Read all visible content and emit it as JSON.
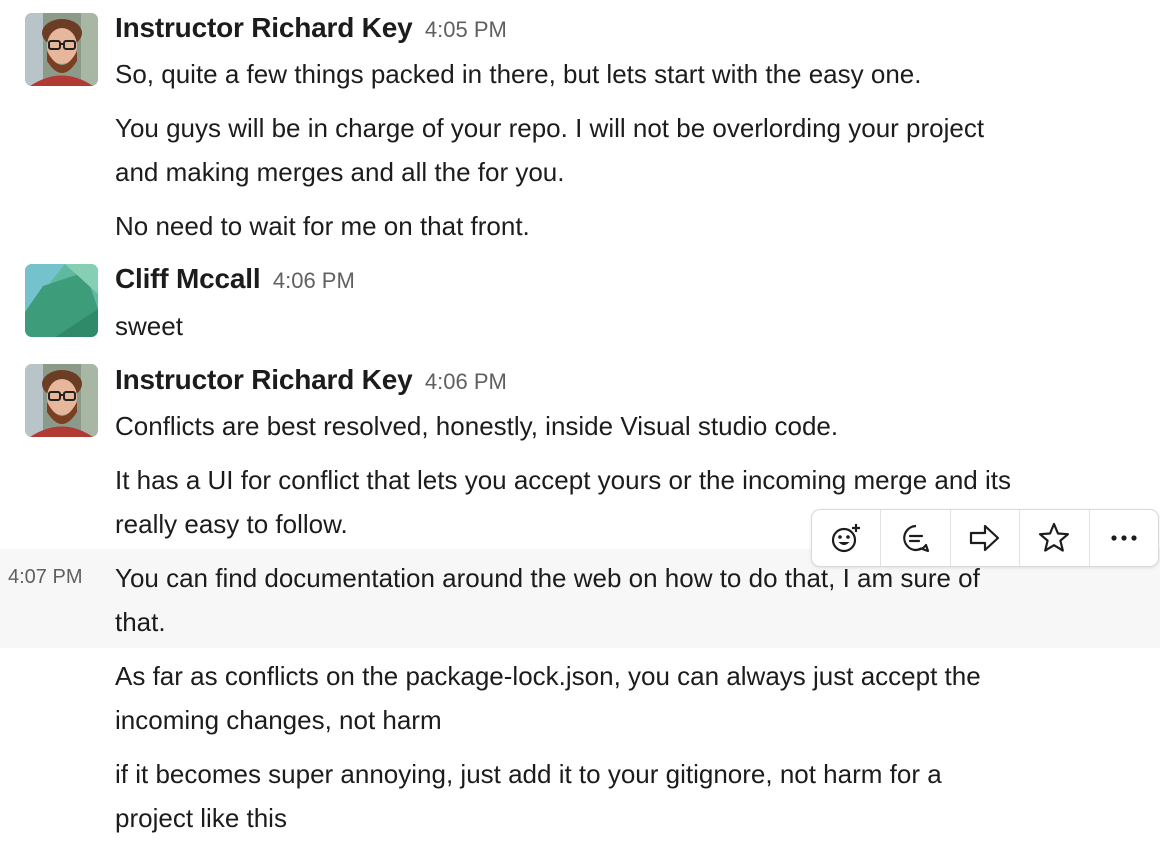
{
  "messages": [
    {
      "author": "Instructor Richard Key",
      "time": "4:05 PM",
      "lines": [
        "So, quite a few things packed in there, but lets start with the easy one.",
        "You guys will be in charge of your repo. I will not be overlording your project",
        "and making merges and all the for you.",
        "No need to wait for me on that front."
      ]
    },
    {
      "author": "Cliff Mccall",
      "time": "4:06 PM",
      "lines": [
        "sweet"
      ]
    },
    {
      "author": "Instructor Richard Key",
      "time": "4:06 PM",
      "lines": [
        "Conflicts are best resolved, honestly, inside Visual studio code.",
        "It has a UI for conflict that lets you accept yours or the incoming merge and its",
        "really easy to follow."
      ]
    }
  ],
  "continuation": {
    "time": "4:07 PM",
    "lines": [
      "You can find documentation around the web on how to do that, I am sure of",
      "that.",
      "As far as conflicts on the package-lock.json, you can always just accept the",
      "incoming changes, not harm",
      "if it becomes super annoying, just add it to your gitignore, not harm for a",
      "project like this"
    ]
  },
  "actions": {
    "icons": [
      "add-reaction-icon",
      "reply-thread-icon",
      "share-message-icon",
      "star-icon",
      "more-actions-icon"
    ]
  },
  "colors": {
    "text": "#1d1c1d",
    "timestamp": "#616061",
    "hover_background": "#f7f7f7",
    "avatar_green": "#3d9c7a",
    "avatar_teal": "#6fc0c8"
  }
}
